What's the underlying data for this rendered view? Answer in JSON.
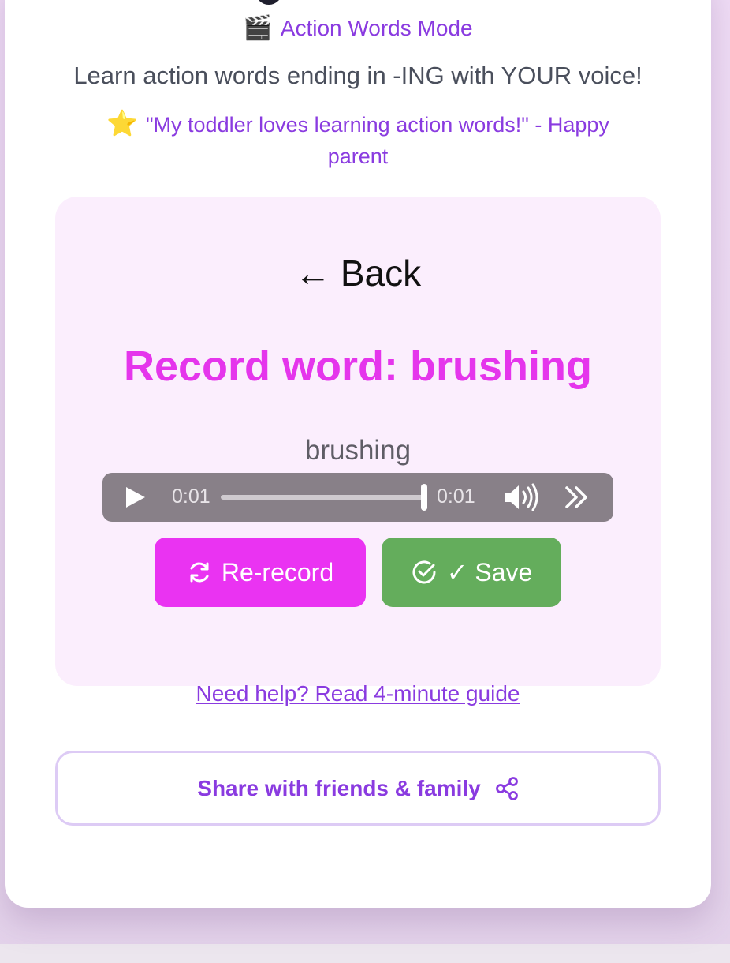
{
  "header": {
    "mode_emoji": "🎬",
    "mode_label": "Action Words Mode",
    "subtitle": "Learn action words ending in -ING with YOUR voice!",
    "testimonial_star": "⭐",
    "testimonial": "\"My toddler loves learning action words!\" - Happy parent"
  },
  "recorder": {
    "back_arrow": "←",
    "back_label": "Back",
    "title": "Record word: brushing",
    "word": "brushing",
    "audio": {
      "current_time": "0:01",
      "duration": "0:01",
      "progress": 1.0
    },
    "rerecord_label": "Re-record",
    "save_label": "✓ Save"
  },
  "footer": {
    "help_link": "Need help? Read 4-minute guide",
    "share_label": "Share with friends & family"
  },
  "colors": {
    "accent_purple": "#8a3be0",
    "accent_magenta": "#e535ec",
    "save_green": "#64ad5c",
    "panel_bg": "#fbeefd"
  },
  "icons": [
    "play-icon",
    "volume-icon",
    "more-icon",
    "refresh-icon",
    "check-circle-icon",
    "share-icon"
  ]
}
